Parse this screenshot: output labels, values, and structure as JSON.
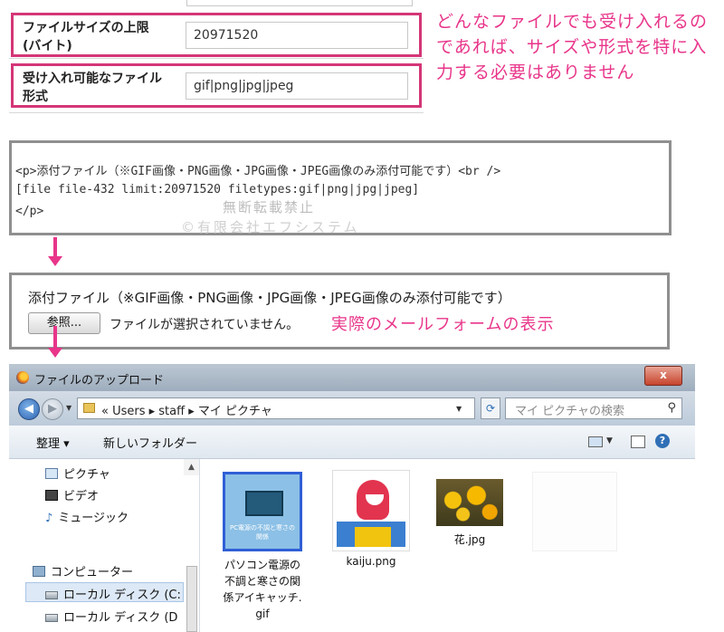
{
  "settings": {
    "rows": [
      {
        "label": "ファイルサイズの上限 (バイト)",
        "value": "20971520"
      },
      {
        "label": "受け入れ可能なファイル形式",
        "value": "gif|png|jpg|jpeg"
      }
    ],
    "note": "どんなファイルでも受け入れるのであれば、サイズや形式を特に入力する必要はありません"
  },
  "code": {
    "lines": [
      "<p>添付ファイル（※GIF画像・PNG画像・JPG画像・JPEG画像のみ添付可能です）<br />",
      "[file file-432 limit:20971520 filetypes:gif|png|jpg|jpeg]",
      "</p>"
    ],
    "watermark_1": "無断転載禁止",
    "watermark_2": "©有限会社エフシステム"
  },
  "form_preview": {
    "text": "添付ファイル（※GIF画像・PNG画像・JPG画像・JPEG画像のみ添付可能です）",
    "browse_label": "参照...",
    "no_file_text": "ファイルが選択されていません。",
    "caption": "実際のメールフォームの表示"
  },
  "dialog": {
    "title": "ファイルのアップロード",
    "close_label": "x",
    "path": "« Users ▸ staff ▸ マイ ピクチャ",
    "search_placeholder": "マイ ピクチャの検索",
    "toolbar": {
      "organize": "整理 ▾",
      "new_folder": "新しいフォルダー"
    },
    "nav_items": [
      {
        "label": "ピクチャ",
        "icon": "pictures-icon"
      },
      {
        "label": "ビデオ",
        "icon": "video-icon"
      },
      {
        "label": "ミュージック",
        "icon": "music-icon"
      },
      {
        "label": "コンピューター",
        "icon": "computer-icon"
      },
      {
        "label": "ローカル ディスク (C:",
        "icon": "disk-icon"
      },
      {
        "label": "ローカル ディスク (D",
        "icon": "disk-icon"
      }
    ],
    "files": [
      {
        "name": "パソコン電源の不調と寒さの関係アイキャッチ.gif",
        "name_lines": [
          "パソコン電源の",
          "不調と寒さの関",
          "係アイキャッチ.",
          "gif"
        ],
        "thumb_caption": "PC電源の不調と寒さの関係",
        "selected": true
      },
      {
        "name": "kaiju.png"
      },
      {
        "name": "花.jpg"
      }
    ]
  },
  "colors": {
    "accent_pink": "#e8358a",
    "frame_magenta": "#d43677",
    "select_blue": "#2f5fd6"
  }
}
